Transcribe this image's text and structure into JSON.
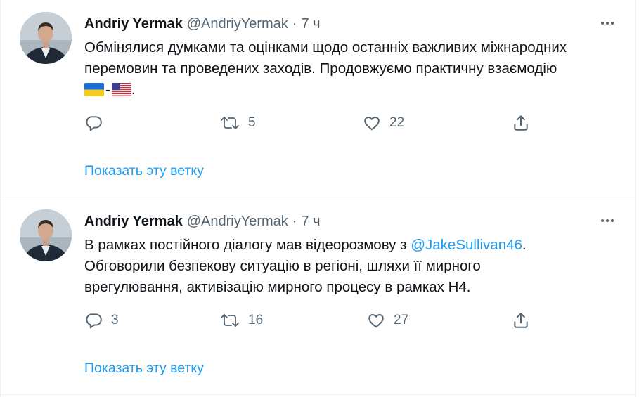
{
  "colors": {
    "accent": "#1d9bf0",
    "muted": "#536471",
    "text": "#0f1419",
    "divider": "#eff3f4"
  },
  "tweets": [
    {
      "name": "Andriy Yermak",
      "handle": "@AndriyYermak",
      "separator": "·",
      "time": "7 ч",
      "lines": [
        "Обмінялися думками та оцінками щодо останніх важливих міжнародних",
        "перемовин та проведених заходів. Продовжуємо практичну взаємодію"
      ],
      "flags": [
        "ukraine-flag-icon",
        "usa-flag-icon"
      ],
      "flag_separator": "-",
      "trailing": ".",
      "replies": "",
      "retweets": "5",
      "likes": "22",
      "show_thread": "Показать эту ветку"
    },
    {
      "name": "Andriy Yermak",
      "handle": "@AndriyYermak",
      "separator": "·",
      "time": "7 ч",
      "line1_prefix": "В рамках постійного діалогу мав відеорозмову з ",
      "mention": "@JakeSullivan46",
      "line1_suffix": ".",
      "lines": [
        "Обговорили безпекову ситуацію в регіоні, шляхи її мирного",
        "врегулювання, активізацію мирного процесу в рамках Н4."
      ],
      "replies": "3",
      "retweets": "16",
      "likes": "27",
      "show_thread": "Показать эту ветку"
    }
  ],
  "icons": {
    "reply": "reply-icon",
    "retweet": "retweet-icon",
    "like": "like-icon",
    "share": "share-icon",
    "more": "more-icon"
  }
}
